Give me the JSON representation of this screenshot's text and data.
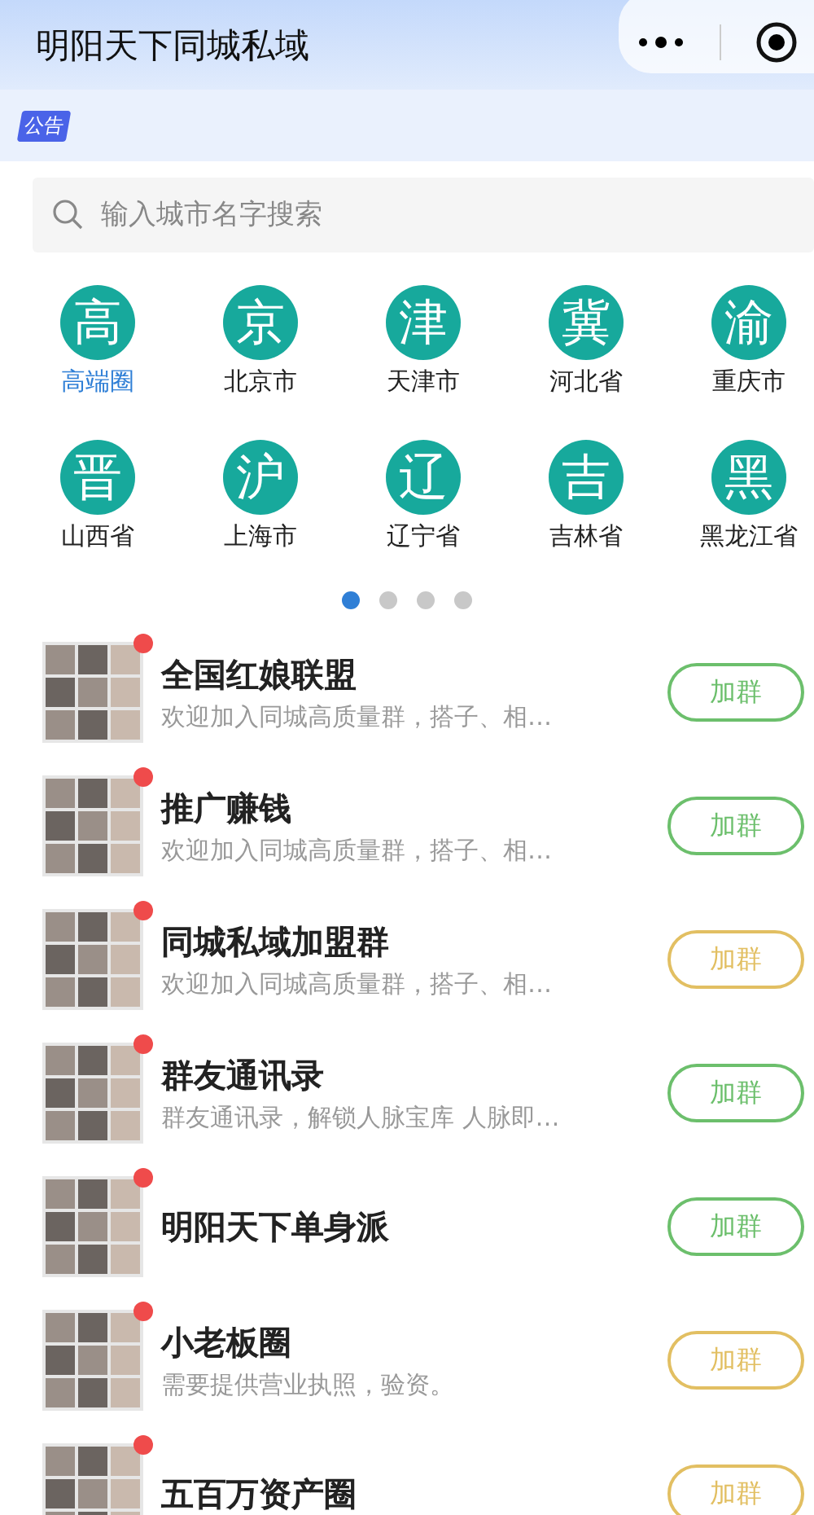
{
  "header": {
    "title": "明阳天下同城私域"
  },
  "notice": {
    "badge": "公告"
  },
  "search": {
    "placeholder": "输入城市名字搜索"
  },
  "cities": [
    {
      "icon": "高",
      "label": "高端圈",
      "selected": true
    },
    {
      "icon": "京",
      "label": "北京市",
      "selected": false
    },
    {
      "icon": "津",
      "label": "天津市",
      "selected": false
    },
    {
      "icon": "冀",
      "label": "河北省",
      "selected": false
    },
    {
      "icon": "渝",
      "label": "重庆市",
      "selected": false
    },
    {
      "icon": "晋",
      "label": "山西省",
      "selected": false
    },
    {
      "icon": "沪",
      "label": "上海市",
      "selected": false
    },
    {
      "icon": "辽",
      "label": "辽宁省",
      "selected": false
    },
    {
      "icon": "吉",
      "label": "吉林省",
      "selected": false
    },
    {
      "icon": "黑",
      "label": "黑龙江省",
      "selected": false
    }
  ],
  "pager": [
    {
      "selected": true
    },
    {
      "selected": false
    },
    {
      "selected": false
    },
    {
      "selected": false
    }
  ],
  "groups": [
    {
      "name": "全国红娘联盟",
      "desc": "欢迎加入同城高质量群，搭子、相…",
      "button": "加群",
      "color": "#6cbf6c"
    },
    {
      "name": "推广赚钱",
      "desc": "欢迎加入同城高质量群，搭子、相…",
      "button": "加群",
      "color": "#6cbf6c"
    },
    {
      "name": "同城私域加盟群",
      "desc": "欢迎加入同城高质量群，搭子、相…",
      "button": "加群",
      "color": "#e2bf62"
    },
    {
      "name": "群友通讯录",
      "desc": "群友通讯录，解锁人脉宝库 人脉即…",
      "button": "加群",
      "color": "#6cbf6c"
    },
    {
      "name": "明阳天下单身派",
      "button": "加群",
      "color": "#6cbf6c"
    },
    {
      "name": "小老板圈",
      "desc": "需要提供营业执照，验资。",
      "button": "加群",
      "color": "#e2bf62"
    },
    {
      "name": "五百万资产圈",
      "button": "加群",
      "color": "#e2bf62"
    }
  ]
}
